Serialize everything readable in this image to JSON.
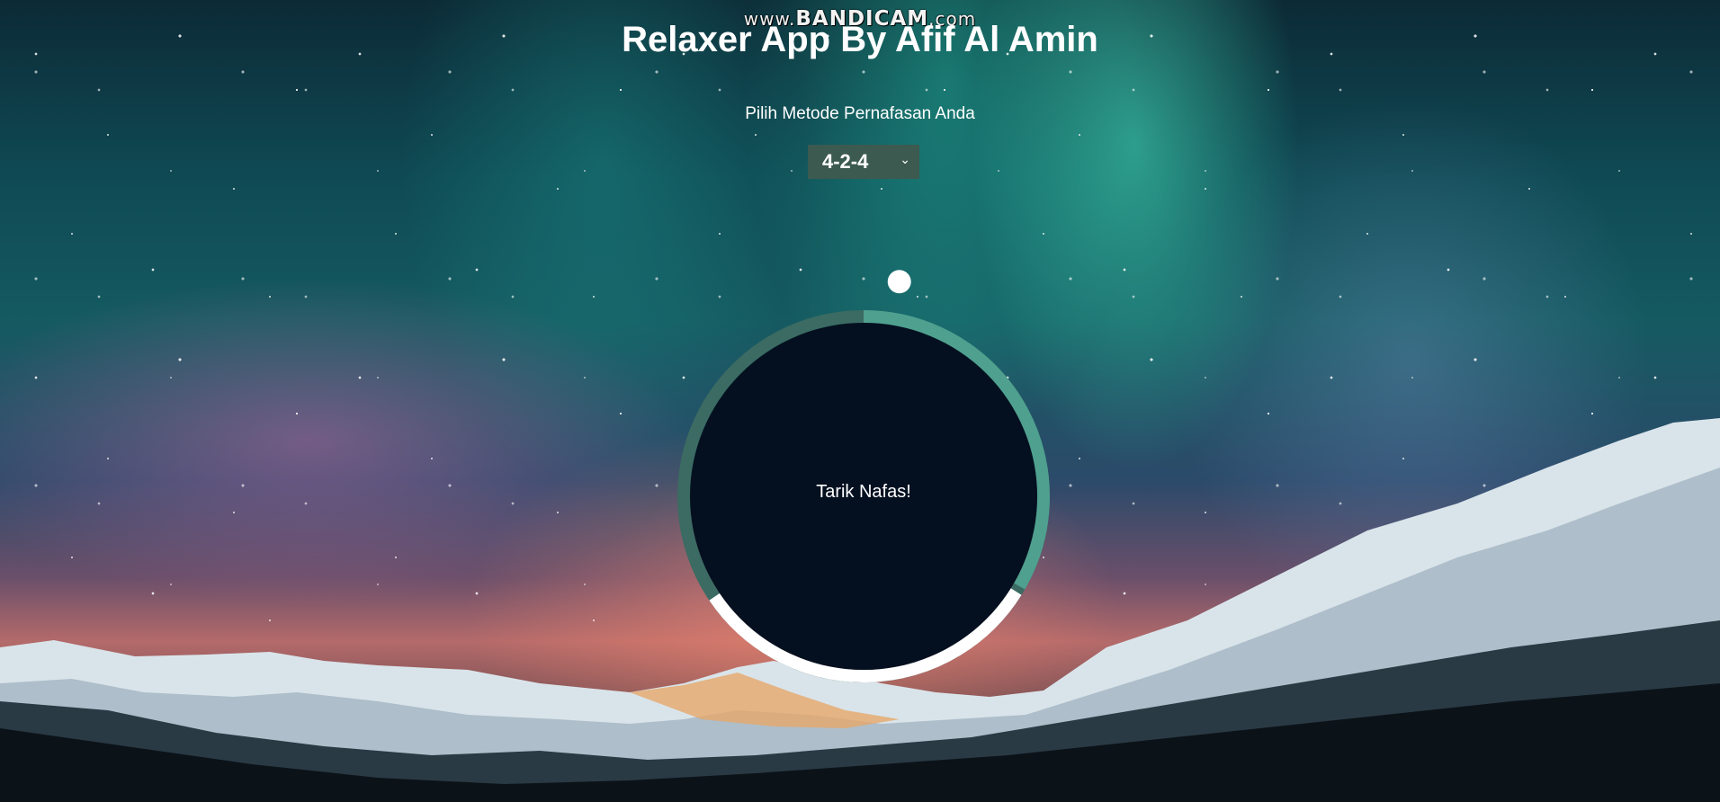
{
  "watermark": {
    "prefix": "www.",
    "brand": "BANDICAM",
    "suffix": ".com"
  },
  "app": {
    "title": "Relaxer App By Afif Al Amin",
    "subtitle": "Pilih Metode Pernafasan Anda"
  },
  "method_select": {
    "selected": "4-2-4",
    "chevron": "⌄",
    "icon": "chevron-down-icon"
  },
  "breath_circle": {
    "instruction": "Tarik Nafas!",
    "progress": 0.46
  },
  "colors": {
    "circle_fill": "#041020",
    "ring_dark": "#3b6b62",
    "ring_light": "#4fa08f",
    "ring_white": "#ffffff",
    "select_bg": "#3c5a4f"
  }
}
